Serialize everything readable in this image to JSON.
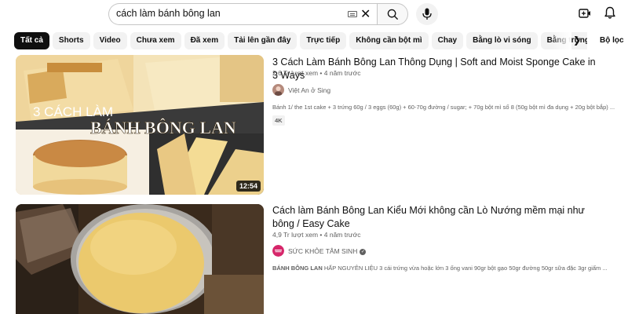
{
  "search": {
    "query": "cách làm bánh bông lan"
  },
  "chips": [
    {
      "label": "Tất cả",
      "active": true
    },
    {
      "label": "Shorts",
      "active": false
    },
    {
      "label": "Video",
      "active": false
    },
    {
      "label": "Chưa xem",
      "active": false
    },
    {
      "label": "Đã xem",
      "active": false
    },
    {
      "label": "Tải lên gần đây",
      "active": false
    },
    {
      "label": "Trực tiếp",
      "active": false
    },
    {
      "label": "Không cần bột mì",
      "active": false
    },
    {
      "label": "Chay",
      "active": false
    },
    {
      "label": "Bằng lò vi sóng",
      "active": false
    },
    {
      "label": "Bằng trứng vịt",
      "active": false
    },
    {
      "label": "Bằng",
      "active": false
    }
  ],
  "filters_label": "Bộ lọc",
  "results": [
    {
      "title": "3 Cách Làm Bánh Bông Lan Thông Dụng | Soft and Moist Sponge Cake in 3 Ways",
      "views": "2,6 Tr lượt xem",
      "age": "4 năm trước",
      "channel": "Việt An ở Sing",
      "description": "Bánh 1/ the 1st cake + 3 trứng 60g / 3 eggs (60g) + 60-70g đường / sugar; + 70g bột mì số 8 (50g bột mì đa dụng + 20g bột bắp) ...",
      "badge": "4K",
      "duration": "12:54",
      "thumb_text_1": "3 CÁCH LÀM",
      "thumb_text_2": "BÁNH BÔNG LAN"
    },
    {
      "title": "Cách làm Bánh Bông Lan Kiểu Mới không cần Lò Nướng mềm mại như bông / Easy Cake",
      "views": "4,9 Tr lượt xem",
      "age": "4 năm trước",
      "channel": "SỨC KHỎE TÂM SINH",
      "description_bold": "BÁNH BÔNG LAN",
      "description": " HẤP NGUYÊN LIỆU 3 cái trứng vừa hoặc lớn 3 ống vani 90gr bột gạo 50gr đường 50gr sữa đặc 3gr giấm ..."
    }
  ],
  "colors": {
    "accent": "#0f0f0f",
    "chip_bg": "#f2f2f2",
    "meta_text": "#606060"
  }
}
